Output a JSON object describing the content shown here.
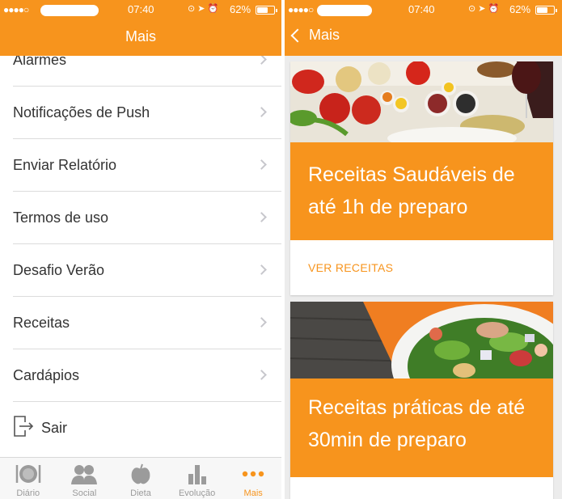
{
  "status_bar": {
    "time": "07:40",
    "battery": "62%"
  },
  "left": {
    "nav_title": "Mais",
    "menu": [
      {
        "label": "Alarmes"
      },
      {
        "label": "Notificações de Push"
      },
      {
        "label": "Enviar Relatório"
      },
      {
        "label": "Termos de uso"
      },
      {
        "label": "Desafio Verão"
      },
      {
        "label": "Receitas"
      },
      {
        "label": "Cardápios"
      }
    ],
    "logout_label": "Sair",
    "tabs": [
      {
        "label": "Diário",
        "icon": "plate-icon"
      },
      {
        "label": "Social",
        "icon": "people-icon"
      },
      {
        "label": "Dieta",
        "icon": "apple-icon"
      },
      {
        "label": "Evolução",
        "icon": "bar-chart-icon"
      },
      {
        "label": "Mais",
        "icon": "more-dots-icon"
      }
    ],
    "active_tab": "Mais"
  },
  "right": {
    "back_label": "Mais",
    "cards": [
      {
        "title": "Receitas Saudáveis de até 1h de preparo",
        "cta": "VER RECEITAS"
      },
      {
        "title": "Receitas práticas de até 30min de preparo"
      }
    ]
  },
  "colors": {
    "accent": "#f7941d",
    "inactive_tab": "#9b9b9b",
    "separator": "#dcdcdc"
  }
}
